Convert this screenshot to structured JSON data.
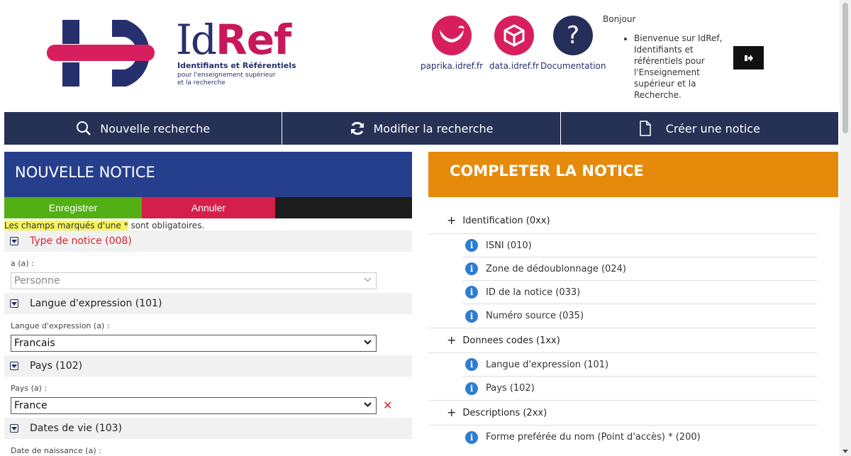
{
  "header": {
    "logo": {
      "id_text": "Id",
      "ref_text": "Ref",
      "subtitle_line1": "Identifiants et Référentiels",
      "subtitle_line2": "pour l'enseignement supérieur",
      "subtitle_line3": "et la recherche"
    },
    "links": [
      {
        "label": "paprika.idref.fr",
        "icon": "paprika-icon",
        "color": "#d81f5e"
      },
      {
        "label": "data.idref.fr",
        "icon": "data-cube-icon",
        "color": "#d81f5e"
      },
      {
        "label": "Documentation",
        "icon": "question-icon",
        "color": "#262f5a"
      }
    ],
    "greeting": "Bonjour",
    "welcome_message": "Bienvenue sur IdRef, Identifiants et référentiels pour l'Enseignement supérieur et la Recherche.",
    "logout_icon": "logout-icon"
  },
  "toolbar": {
    "new_search": "Nouvelle recherche",
    "modify_search": "Modifier la recherche",
    "create_record": "Créer une notice"
  },
  "left_panel": {
    "title": "NOUVELLE NOTICE",
    "save_label": "Enregistrer",
    "cancel_label": "Annuler",
    "required_note_highlight": "Les champs marqués d'une *",
    "required_note_rest": " sont obligatoires.",
    "sections": {
      "record_type": {
        "title": "Type de notice (008)",
        "field_label": "a (a) :",
        "value": "Personne"
      },
      "language": {
        "title": "Langue d'expression (101)",
        "field_label": "Langue d'expression (a) :",
        "value": "Francais"
      },
      "country": {
        "title": "Pays (102)",
        "field_label": "Pays (a) :",
        "value": "France"
      },
      "dates": {
        "title": "Dates de vie (103)",
        "field_label": "Date de naissance (a) :"
      }
    }
  },
  "right_panel": {
    "title": "COMPLETER LA NOTICE",
    "groups": [
      {
        "label": "Identification (0xx)",
        "items": [
          "ISNI (010)",
          "Zone de dédoublonnage (024)",
          "ID de la notice (033)",
          "Numéro source (035)"
        ]
      },
      {
        "label": "Donnees codes (1xx)",
        "items": [
          "Langue d'expression (101)",
          "Pays (102)"
        ]
      },
      {
        "label": "Descriptions (2xx)",
        "items": [
          "Forme preférée du nom (Point d'accès) * (200)"
        ]
      }
    ]
  },
  "colors": {
    "navy": "#263156",
    "left_header": "#263f8c",
    "right_header": "#e58a0b",
    "save_green": "#52b014",
    "cancel_red": "#d41f4a",
    "required_red": "#d9232e",
    "info_blue": "#2d7dd2",
    "highlight": "#f6f45e"
  }
}
